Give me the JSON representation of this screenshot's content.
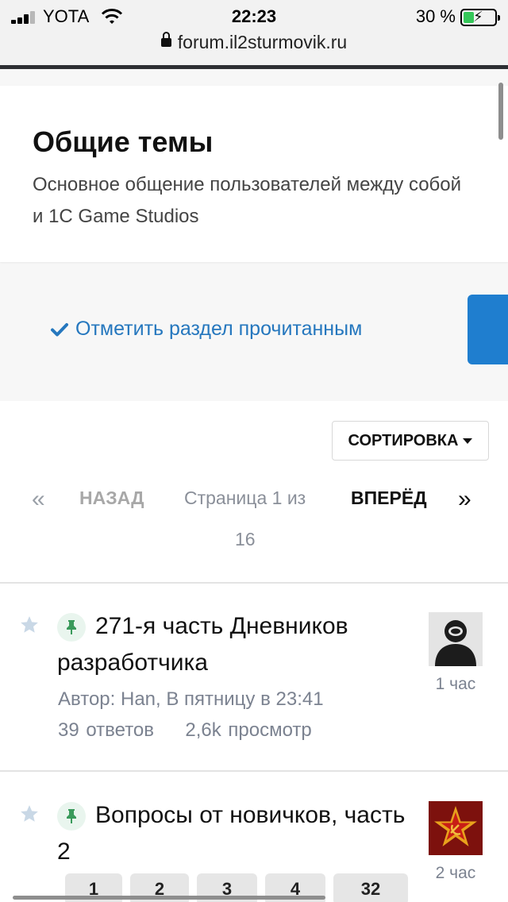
{
  "status_bar": {
    "carrier": "YOTA",
    "time": "22:23",
    "battery_percent": "30 %"
  },
  "browser": {
    "url": "forum.il2sturmovik.ru"
  },
  "forum": {
    "title": "Общие темы",
    "description": "Основное общение пользователей между собой и 1C Game Studios"
  },
  "actions": {
    "mark_read": "Отметить раздел прочитанным",
    "sort": "СОРТИРОВКА"
  },
  "pagination": {
    "first": "«",
    "prev": "НАЗАД",
    "info": "Страница 1 из",
    "total": "16",
    "next": "ВПЕРЁД",
    "last": "»"
  },
  "topics": [
    {
      "title": "271-я часть Дневников разработчика",
      "author": "Автор: Han, В пятницу в 23:41",
      "replies": "39 ответов",
      "views": "2,6k просмотр",
      "last_time": "1 час"
    },
    {
      "title": "Вопросы от новичков, часть 2",
      "last_time": "2 час",
      "pages": [
        "1",
        "2",
        "3",
        "4",
        "32"
      ]
    }
  ],
  "colors": {
    "accent": "#2577be",
    "primary_button": "#1f7ecf",
    "pin_badge": "#e9f5ee",
    "pin_icon": "#3a9a5b"
  }
}
